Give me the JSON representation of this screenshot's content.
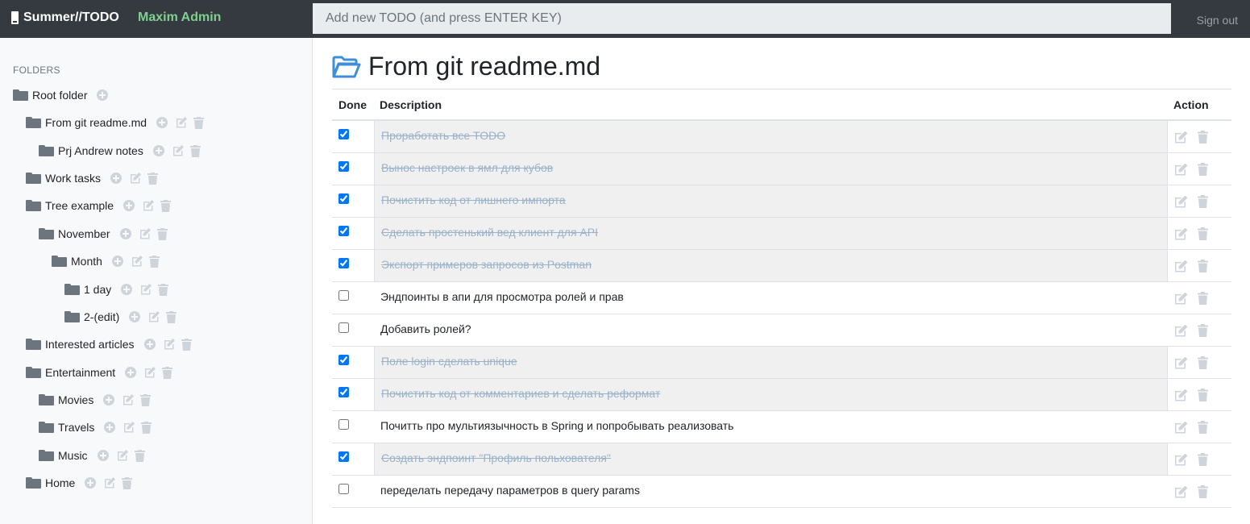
{
  "navbar": {
    "brand": "Summer//TODO",
    "user": "Maxim Admin",
    "new_todo_placeholder": "Add new TODO (and press ENTER KEY)",
    "signout": "Sign out"
  },
  "sidebar": {
    "heading": "FOLDERS",
    "folders": [
      {
        "label": "Root folder",
        "level": 0
      },
      {
        "label": "From git readme.md",
        "level": 1
      },
      {
        "label": "Prj Andrew notes",
        "level": 2
      },
      {
        "label": "Work tasks",
        "level": 1
      },
      {
        "label": "Tree example",
        "level": 1
      },
      {
        "label": "November",
        "level": 2
      },
      {
        "label": "Month",
        "level": 3
      },
      {
        "label": "1 day",
        "level": 4
      },
      {
        "label": "2-(edit)",
        "level": 4
      },
      {
        "label": "Interested articles",
        "level": 1
      },
      {
        "label": "Entertainment",
        "level": 1
      },
      {
        "label": "Movies",
        "level": 2
      },
      {
        "label": "Travels",
        "level": 2
      },
      {
        "label": "Music",
        "level": 2
      },
      {
        "label": "Home",
        "level": 1
      }
    ]
  },
  "main": {
    "title": "From git readme.md",
    "columns": {
      "done": "Done",
      "description": "Description",
      "action": "Action"
    },
    "todos": [
      {
        "done": true,
        "text": "Проработать все TODO"
      },
      {
        "done": true,
        "text": "Вынос настроек в ямл для кубов"
      },
      {
        "done": true,
        "text": "Почистить код от лишнего импорта"
      },
      {
        "done": true,
        "text": "Сделать простенький вед клиент для API"
      },
      {
        "done": true,
        "text": "Экспорт примеров запросов из Postman"
      },
      {
        "done": false,
        "text": "Эндпоинты в апи для просмотра ролей и прав"
      },
      {
        "done": false,
        "text": "Добавить ролей?"
      },
      {
        "done": true,
        "text": "Поле login сделать unique"
      },
      {
        "done": true,
        "text": "Почистить код от комментариев и сделать реформат"
      },
      {
        "done": false,
        "text": "Почитть про мультиязычность в Spring и попробывать реализовать"
      },
      {
        "done": true,
        "text": "Создать эндпоинт \"Профиль польхователя\""
      },
      {
        "done": false,
        "text": "переделать передачу параметров в query params"
      }
    ]
  },
  "colors": {
    "navbar_bg": "#343a40",
    "user_accent": "#7fd08f",
    "folder_icon": "#6c757d",
    "title_icon": "#3f8fd8",
    "done_text": "#9ab2c8"
  },
  "icons": {
    "brand": "note-icon",
    "folder": "folder-icon",
    "title": "folder-open-icon",
    "add": "plus-circle-icon",
    "edit": "edit-icon",
    "delete": "trash-icon"
  }
}
